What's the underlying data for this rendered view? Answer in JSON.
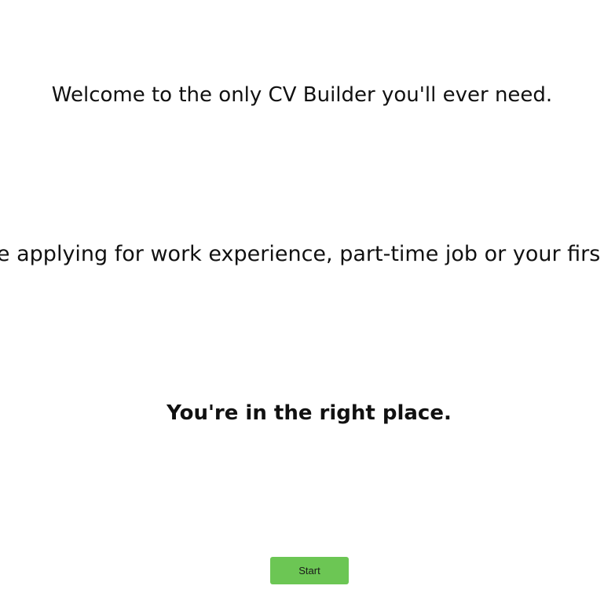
{
  "welcome": {
    "headline": "Welcome to the only CV Builder you'll ever need.",
    "applying_line": "'re applying for work experience, part-time job or your firs",
    "right_place": "You're in the right place.",
    "start_label": "Start"
  },
  "colors": {
    "start_button_bg": "#6cc654",
    "text": "#111111",
    "background": "#ffffff"
  }
}
